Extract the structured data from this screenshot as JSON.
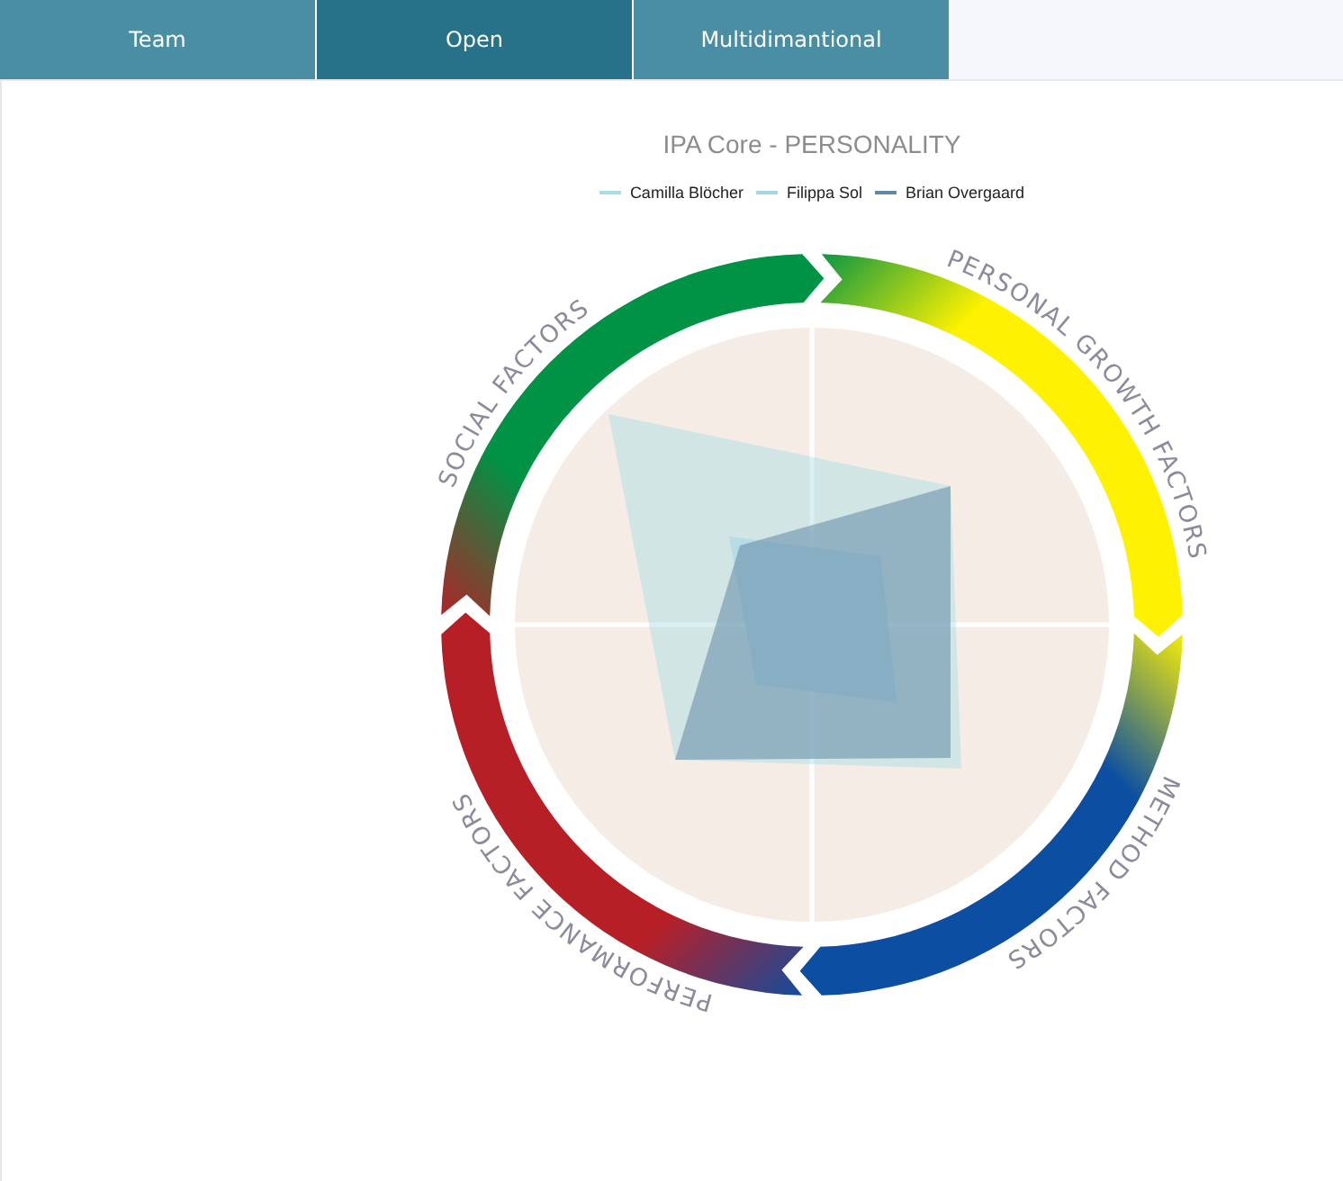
{
  "tabs": [
    {
      "label": "Team",
      "selected": false
    },
    {
      "label": "Open",
      "selected": true
    },
    {
      "label": "Multidimantional",
      "selected": false
    }
  ],
  "chart": {
    "title": "IPA Core - PERSONALITY",
    "legend": [
      {
        "name": "Camilla Blöcher",
        "color": "#a9dde4"
      },
      {
        "name": "Filippa Sol",
        "color": "#a3d6e6"
      },
      {
        "name": "Brian Overgaard",
        "color": "#5e88a6"
      }
    ],
    "factors": [
      {
        "label": "SOCIAL FACTORS",
        "color": "#009245"
      },
      {
        "label": "PERSONAL GROWTH FACTORS",
        "color": "#fff200"
      },
      {
        "label": "METHOD FACTORS",
        "color": "#0b4ea2"
      },
      {
        "label": "PERFORMANCE FACTORS",
        "color": "#b71f27"
      }
    ]
  }
}
